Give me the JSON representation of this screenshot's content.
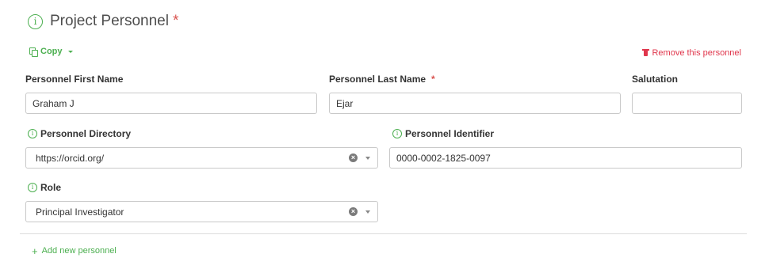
{
  "header": {
    "info_icon": "info-icon",
    "title": "Project Personnel",
    "required_mark": "*"
  },
  "toolbar": {
    "copy_icon": "copy-icon",
    "copy_label": "Copy",
    "remove_icon": "trash-icon",
    "remove_label": "Remove this personnel"
  },
  "fields": {
    "first_name": {
      "label": "Personnel First Name",
      "value": "Graham J"
    },
    "last_name": {
      "label": "Personnel Last Name",
      "required_mark": "*",
      "value": "Ejar"
    },
    "salutation": {
      "label": "Salutation",
      "value": ""
    },
    "directory": {
      "label": "Personnel Directory",
      "value": "https://orcid.org/"
    },
    "identifier": {
      "label": "Personnel Identifier",
      "value": "0000-0002-1825-0097"
    },
    "role": {
      "label": "Role",
      "value": "Principal Investigator"
    }
  },
  "footer": {
    "add_icon": "plus-icon",
    "add_label": "Add new personnel"
  },
  "colors": {
    "accent": "#4caf50",
    "danger": "#e0364c",
    "required": "#d9534f"
  }
}
